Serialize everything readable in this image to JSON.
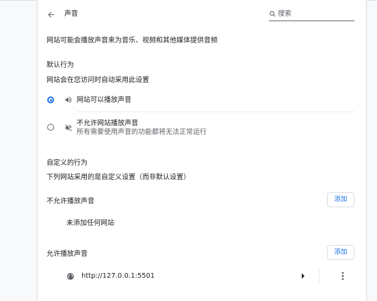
{
  "header": {
    "back_icon": "arrow-left-icon",
    "title": "声音",
    "search": {
      "icon": "search-icon",
      "placeholder": "搜索",
      "value": ""
    }
  },
  "description": "网站可能会播放声音来为音乐、视频和其他媒体提供音频",
  "default_behavior": {
    "heading": "默认行为",
    "subtitle": "网站会在您访问时自动采用此设置",
    "options": [
      {
        "label": "网站可以播放声音",
        "selected": true,
        "icon": "volume-icon"
      },
      {
        "label": "不允许网站播放声音",
        "sublabel": "所有需要使用声音的功能都将无法正常运行",
        "selected": false,
        "icon": "volume-off-icon"
      }
    ]
  },
  "custom_behavior": {
    "heading": "自定义的行为",
    "subtitle": "下列网站采用的是自定义设置（而非默认设置）",
    "blocked": {
      "heading": "不允许播放声音",
      "add_label": "添加",
      "empty_text": "未添加任何网站"
    },
    "allowed": {
      "heading": "允许播放声音",
      "add_label": "添加",
      "sites": [
        {
          "url": "http://127.0.0.1:5501",
          "icon": "globe-icon"
        }
      ]
    }
  },
  "colors": {
    "accent": "#1a73e8",
    "text": "#202124",
    "secondary": "#5f6368"
  }
}
